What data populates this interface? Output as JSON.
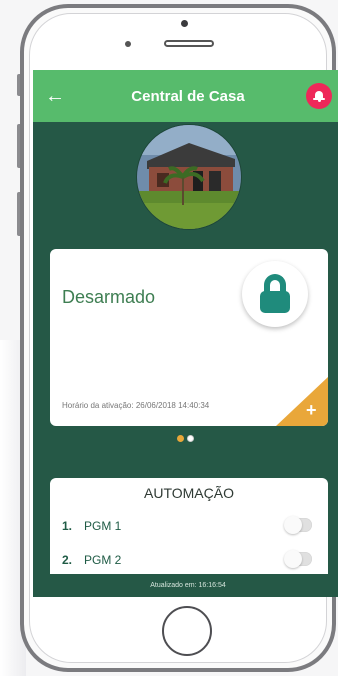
{
  "header": {
    "back_icon": "back-arrow-icon",
    "title": "Central de Casa",
    "alert_icon": "bell-icon",
    "alert_color": "#ee2859",
    "color": "#57bb6c"
  },
  "status_card": {
    "state": "Desarmado",
    "lock_icon": "lock-icon",
    "lock_color": "#1f8b7c",
    "activation_text": "Horário da ativação: 26/06/2018 14:40:34",
    "add_icon": "plus-icon",
    "add_color": "#e9a73a"
  },
  "pager": {
    "total": 2,
    "active_index": 0
  },
  "automation": {
    "title": "AUTOMAÇÃO",
    "items": [
      {
        "num": "1.",
        "label": "PGM 1",
        "enabled": false
      },
      {
        "num": "2.",
        "label": "PGM 2",
        "enabled": false
      }
    ]
  },
  "footer": {
    "updated_text": "Atualizado em: 16:16:54"
  },
  "theme": {
    "screen_bg": "#255846"
  }
}
